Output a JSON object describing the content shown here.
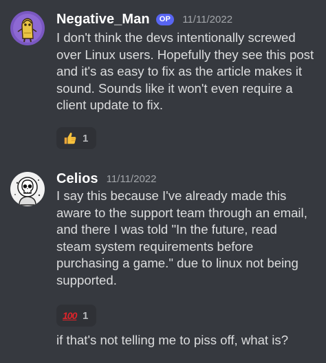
{
  "messages": [
    {
      "username": "Negative_Man",
      "badge": "OP",
      "timestamp": "11/11/2022",
      "avatar_icon": "yellow-cartoon-figure-avatar",
      "lines": [
        "I don't think the devs intentionally screwed",
        "over Linux users. Hopefully they see this post",
        "and it's as easy to fix as the article makes it",
        "sound. Sounds like it won't even require a",
        "client update to fix."
      ],
      "reaction": {
        "emoji": "thumbs-up-icon",
        "count": "1"
      }
    },
    {
      "username": "Celios",
      "timestamp": "11/11/2022",
      "avatar_icon": "skull-astronaut-avatar",
      "lines": [
        "I say this because I've already made this",
        "aware to the support team through an email,",
        "and there I was told \"In the future, read",
        "steam system requirements before",
        "purchasing a game.\" due to linux not being",
        "supported."
      ],
      "reaction": {
        "emoji": "hundred-points-icon",
        "emoji_text": "100",
        "count": "1"
      },
      "followup": "if that's not telling me to piss off, what is?"
    }
  ],
  "colors": {
    "background": "#36393f",
    "text": "#dcddde",
    "username": "#ffffff",
    "timestamp": "#a3a6aa",
    "badge": "#5865f2",
    "reaction_bg": "#2f3136"
  }
}
